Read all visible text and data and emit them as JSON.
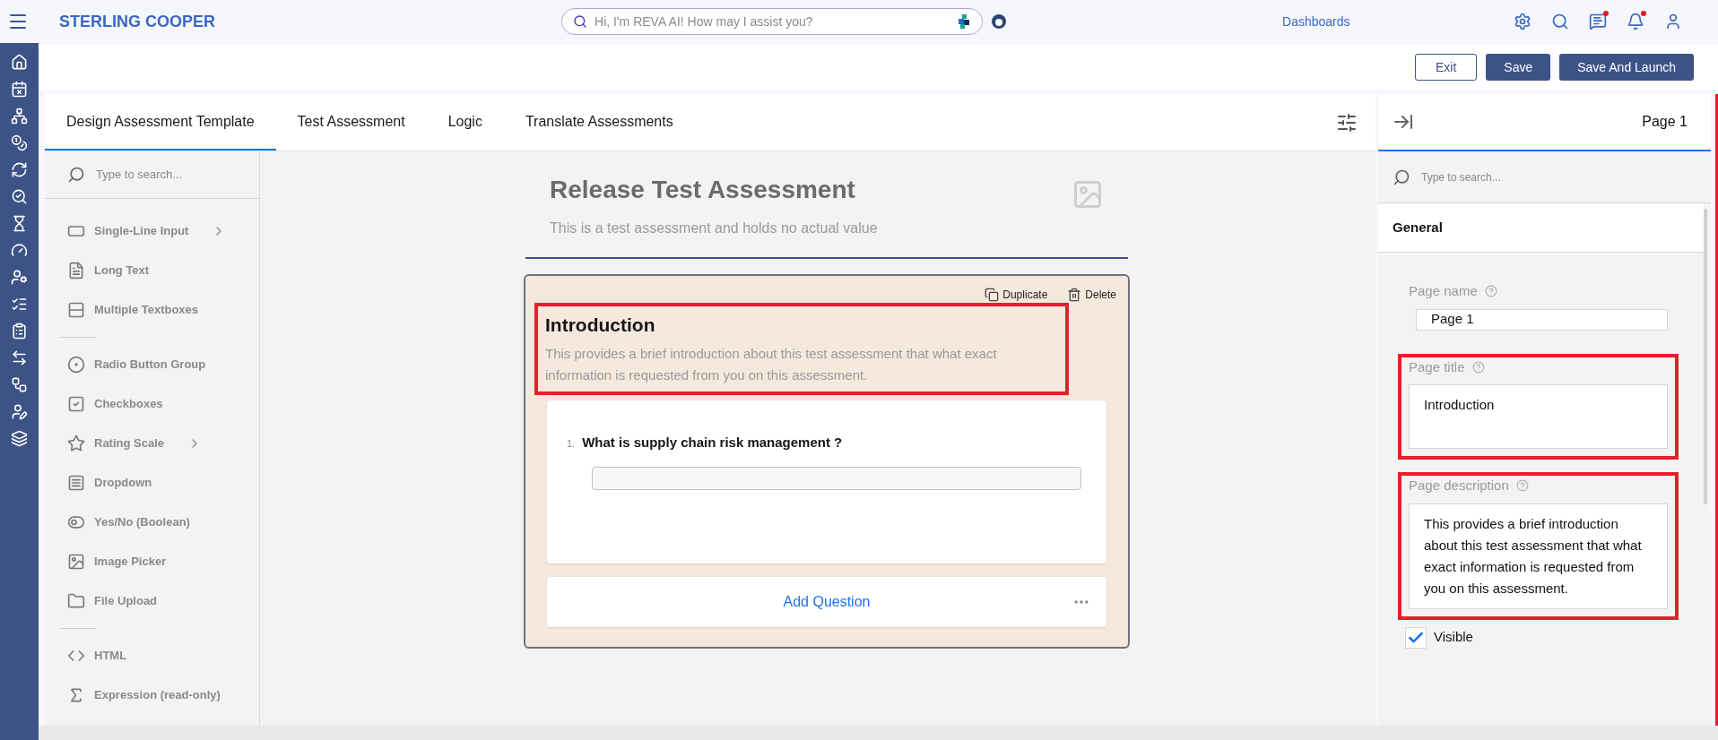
{
  "header": {
    "brand": "STERLING COOPER",
    "search_placeholder": "Hi, I'm REVA AI! How may I assist you?",
    "nav_link": "Dashboards",
    "notifications": [
      {
        "unread": false
      },
      {
        "unread": false
      },
      {
        "unread": true
      },
      {
        "unread": true
      },
      {
        "unread": false
      }
    ]
  },
  "actions": [
    {
      "label": "Exit",
      "kind": "outline"
    },
    {
      "label": "Save",
      "kind": "primary"
    },
    {
      "label": "Save And Launch",
      "kind": "primary"
    }
  ],
  "tabs": [
    {
      "label": "Design Assessment Template",
      "selected": true
    },
    {
      "label": "Test Assessment",
      "selected": false
    },
    {
      "label": "Logic",
      "selected": false
    },
    {
      "label": "Translate Assessments",
      "selected": false
    }
  ],
  "toolbox": {
    "search_placeholder": "Type to search...",
    "groups": [
      [
        {
          "label": "Single-Line Input",
          "submenu": true
        },
        {
          "label": "Long Text",
          "submenu": false
        },
        {
          "label": "Multiple Textboxes",
          "submenu": false
        }
      ],
      [
        {
          "label": "Radio Button Group",
          "submenu": false
        },
        {
          "label": "Checkboxes",
          "submenu": false
        },
        {
          "label": "Rating Scale",
          "submenu": true
        },
        {
          "label": "Dropdown",
          "submenu": false
        },
        {
          "label": "Yes/No (Boolean)",
          "submenu": false
        },
        {
          "label": "Image Picker",
          "submenu": false
        },
        {
          "label": "File Upload",
          "submenu": false
        }
      ],
      [
        {
          "label": "HTML",
          "submenu": false
        },
        {
          "label": "Expression (read-only)",
          "submenu": false
        }
      ]
    ]
  },
  "canvas": {
    "title": "Release Test Assessment",
    "description": "This is a test assessment and holds no actual value",
    "page": {
      "actions": [
        "Duplicate",
        "Delete"
      ],
      "title": "Introduction",
      "description": "This provides a brief introduction about this test assessment that what exact information is requested from you on this assessment.",
      "highlighted": true,
      "questions": [
        {
          "number": "1.",
          "text": "What is supply chain risk management ?"
        }
      ],
      "add_question": "Add Question"
    }
  },
  "properties": {
    "title": "Page 1",
    "search_placeholder": "Type to search...",
    "section": "General",
    "fields": [
      {
        "label": "Page name",
        "value": "Page 1",
        "kind": "input",
        "highlighted": false
      },
      {
        "label": "Page title",
        "value": "Introduction",
        "kind": "textarea",
        "highlighted": true
      },
      {
        "label": "Page description",
        "value": "This provides a brief introduction about this test assessment that what exact information is requested from you on this assessment.",
        "kind": "textarea",
        "highlighted": true
      }
    ],
    "visible": {
      "label": "Visible",
      "checked": true
    }
  }
}
